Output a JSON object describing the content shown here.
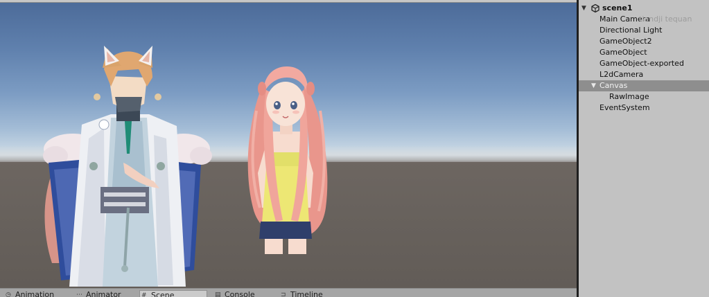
{
  "hierarchy": {
    "scene_name": "scene1",
    "items": [
      {
        "label": "Main Camera"
      },
      {
        "label": "Directional Light"
      },
      {
        "label": "GameObject2"
      },
      {
        "label": "GameObject"
      },
      {
        "label": "GameObject-exported"
      },
      {
        "label": "L2dCamera"
      },
      {
        "label": "Canvas"
      },
      {
        "label": "RawImage"
      },
      {
        "label": "EventSystem"
      }
    ],
    "watermark": "tiandji tequan"
  },
  "bottom_tabs": [
    {
      "label": "Animation",
      "icon": "animation-icon"
    },
    {
      "label": "Animator",
      "icon": "animator-icon"
    },
    {
      "label": "Scene",
      "icon": "scene-hash-icon"
    },
    {
      "label": "Console",
      "icon": "console-icon"
    },
    {
      "label": "Timeline",
      "icon": "timeline-icon"
    }
  ],
  "colors": {
    "selection": "#8e8e8e",
    "panel_bg": "#c2c2c2",
    "sky_top": "#4b6a98",
    "ground": "#6d6661"
  }
}
